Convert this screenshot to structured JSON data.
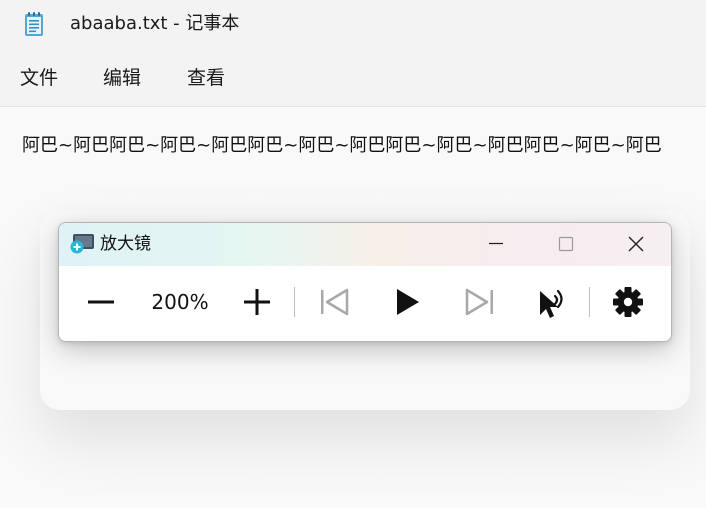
{
  "notepad": {
    "title": "abaaba.txt - 记事本",
    "icon": "notepad-icon",
    "menu": [
      "文件",
      "编辑",
      "查看"
    ],
    "content_line": "阿巴~阿巴阿巴~阿巴~阿巴阿巴~阿巴~阿巴阿巴~阿巴~阿巴阿巴~阿巴~阿巴"
  },
  "magnifier": {
    "title": "放大镜",
    "icon": "magnifier-icon",
    "zoom_level": "200%",
    "controls": [
      "zoom-out-icon",
      "zoom-in-icon",
      "previous-icon",
      "play-icon",
      "next-icon",
      "read-from-pointer-icon",
      "settings-icon"
    ],
    "colors": {
      "active": "#111111",
      "disabled": "#a8a8a8"
    }
  }
}
